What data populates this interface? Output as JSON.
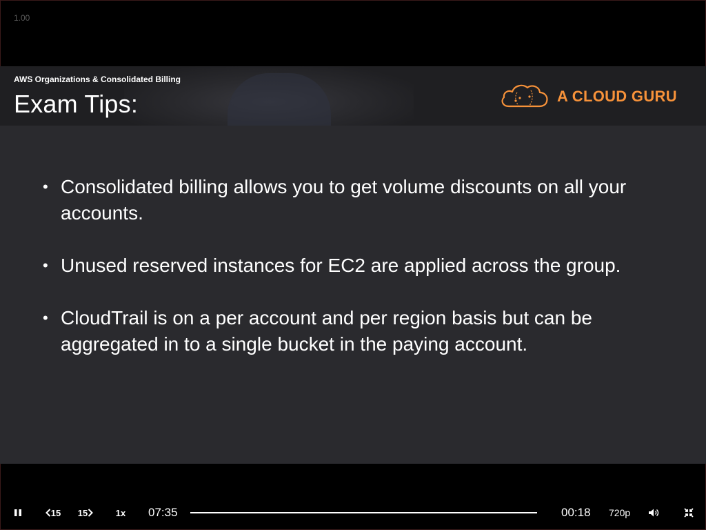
{
  "player": {
    "speed_readout": "1.00",
    "elapsed_time": "07:35",
    "remaining_time": "00:18",
    "playback_rate": "1x",
    "quality": "720p",
    "rewind_label": "15",
    "forward_label": "15",
    "progress": 0.96
  },
  "slide": {
    "course_title": "AWS Organizations & Consolidated Billing",
    "section_title": "Exam Tips:",
    "brand_name": "A CLOUD GURU",
    "bullets": [
      {
        "text": "Consolidated billing allows you to get volume discounts on all your accounts."
      },
      {
        "text": "Unused reserved instances for EC2 are applied across the group."
      },
      {
        "text": "CloudTrail is on a per account and per region basis but can be aggregated in to a single bucket in the paying account."
      }
    ]
  },
  "colors": {
    "brand_orange": "#f7923a",
    "slide_background": "#2a2a2e",
    "player_background": "#000000"
  },
  "icons": {
    "play_pause": "pause-icon",
    "rewind": "rewind-15-icon",
    "forward": "forward-15-icon",
    "volume": "volume-icon",
    "exit_fullscreen": "exit-fullscreen-icon",
    "logo": "cloud-logo-icon"
  }
}
